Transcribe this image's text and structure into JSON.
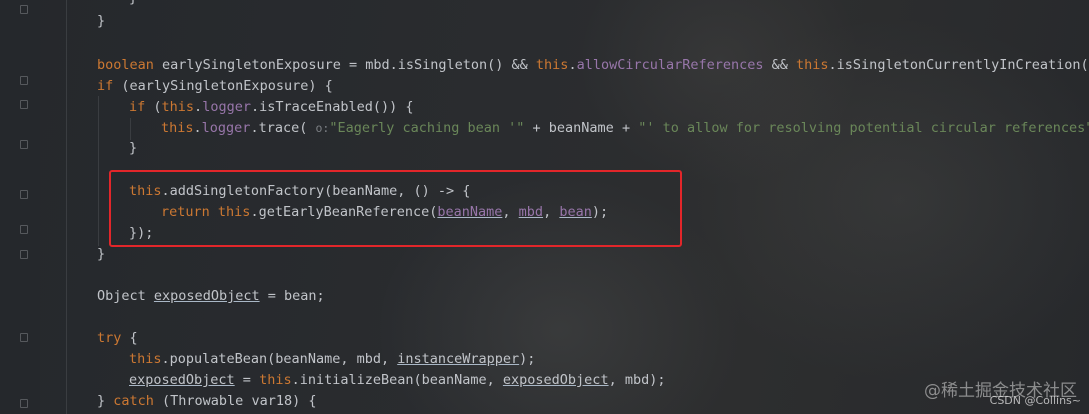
{
  "code": {
    "line0": {
      "text": "}"
    },
    "line1": {
      "text": "}"
    },
    "line2": {
      "kw": "boolean",
      "decl": " earlySingletonExposure = mbd.isSingleton() && ",
      "this1": "this",
      "dot1": ".",
      "field1": "allowCircularReferences",
      "mid": " && ",
      "this2": "this",
      "rest": ".isSingletonCurrentlyInCreation(be"
    },
    "line3": {
      "kw": "if",
      "rest": " (earlySingletonExposure) {"
    },
    "line4": {
      "kw": "if",
      "open": " (",
      "this": "this",
      "dot": ".",
      "field": "logger",
      "rest": ".isTraceEnabled()) {"
    },
    "line5": {
      "this": "this",
      "dot": ".",
      "field": "logger",
      "call": ".trace( ",
      "param_hint": "o:",
      "str1": "\"Eagerly caching bean '\"",
      "concat1": " + beanName + ",
      "str2": "\"' to allow for resolving potential circular references\"",
      "tail": ");"
    },
    "line6": {
      "text": "}"
    },
    "line7": {
      "this": "this",
      "rest": ".addSingletonFactory(beanName, () -> {"
    },
    "line8": {
      "kw": "return",
      "sp": " ",
      "this": "this",
      "call": ".getEarlyBeanReference(",
      "arg1": "beanName",
      "c1": ", ",
      "arg2": "mbd",
      "c2": ", ",
      "arg3": "bean",
      "tail": ");"
    },
    "line9": {
      "text": "});"
    },
    "line10": {
      "text": "}"
    },
    "line11": {
      "type": "Object",
      "sp": " ",
      "var": "exposedObject",
      "rest": " = bean;"
    },
    "line12": {
      "kw": "try",
      "rest": " {"
    },
    "line13": {
      "this": "this",
      "call": ".populateBean(beanName, mbd, ",
      "arg": "instanceWrapper",
      "tail": ");"
    },
    "line14": {
      "var": "exposedObject",
      "eq": " = ",
      "this": "this",
      "call": ".initializeBean(beanName, ",
      "arg": "exposedObject",
      "tail": ", mbd);"
    },
    "line15": {
      "brace": "} ",
      "kw": "catch",
      "rest": " (Throwable var18) {"
    }
  },
  "watermark": {
    "site": "@稀土掘金技术社区",
    "user": "CSDN @Collins~"
  },
  "colors": {
    "keyword": "#cc7832",
    "field": "#9876aa",
    "string": "#6a8759",
    "text": "#c1c4c9",
    "highlight_box": "#e2262a",
    "background": "#23262a"
  }
}
